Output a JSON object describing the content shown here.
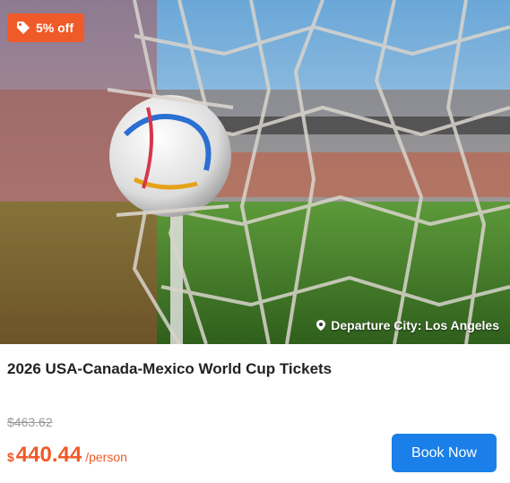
{
  "badge": {
    "icon": "tag-icon",
    "label": "5% off",
    "color": "#f05a28"
  },
  "hero": {
    "image": "soccer-ball-in-goal-net-photo",
    "departure_icon": "map-pin-icon",
    "departure_text": "Departure City: Los Angeles"
  },
  "product": {
    "title": "2026 USA-Canada-Mexico World Cup Tickets",
    "original_price": "$463.62",
    "currency_symbol": "$",
    "price": "440.44",
    "unit": "/person",
    "price_color": "#f05a28"
  },
  "actions": {
    "book_label": "Book Now",
    "button_color": "#1a7fe8"
  }
}
